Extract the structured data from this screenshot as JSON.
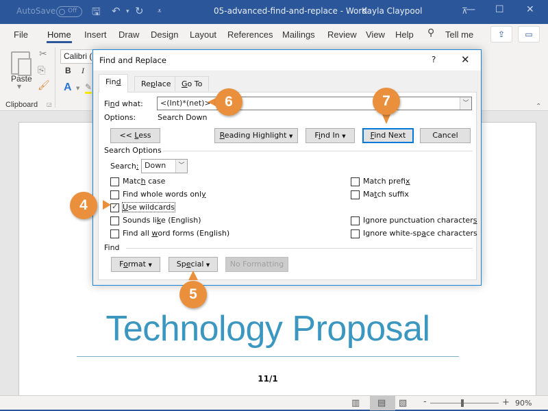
{
  "titlebar": {
    "autosave_label": "AutoSave",
    "autosave_state": "Off",
    "document_title": "05-advanced-find-and-replace - Word",
    "user_name": "Kayla Claypool"
  },
  "ribbon_tabs": [
    "File",
    "Home",
    "Insert",
    "Draw",
    "Design",
    "Layout",
    "References",
    "Mailings",
    "Review",
    "View",
    "Help"
  ],
  "active_tab": "Home",
  "tell_me": "Tell me",
  "ribbon": {
    "paste_label": "Paste",
    "clipboard_label": "Clipboard",
    "font_name": "Calibri (",
    "bold": "B",
    "italic": "I"
  },
  "dialog": {
    "title": "Find and Replace",
    "help": "?",
    "tabs": [
      {
        "pre": "Fin",
        "key": "d",
        "post": ""
      },
      {
        "pre": "Re",
        "key": "p",
        "post": "lace"
      },
      {
        "pre": "",
        "key": "G",
        "post": "o To"
      }
    ],
    "find_what_label": {
      "pre": "Fi",
      "key": "n",
      "post": "d what:"
    },
    "find_what_value": "<(Int)*(net)>",
    "options_label": "Options:",
    "options_value": "Search Down",
    "less_button": {
      "pre": "<< ",
      "key": "L",
      "post": "ess"
    },
    "reading_highlight_button": {
      "pre": "",
      "key": "R",
      "post": "eading Highlight"
    },
    "find_in_button": {
      "pre": "F",
      "key": "i",
      "post": "nd In"
    },
    "find_next_button": {
      "pre": "",
      "key": "F",
      "post": "ind Next"
    },
    "cancel_button": "Cancel",
    "search_options_label": "Search Options",
    "search_label": {
      "pre": "Search",
      "key": ":",
      "post": ""
    },
    "search_value": "Down",
    "checkboxes_left": [
      {
        "pre": "Matc",
        "key": "h",
        "post": " case",
        "checked": false
      },
      {
        "pre": "Find whole words onl",
        "key": "y",
        "post": "",
        "checked": false
      },
      {
        "pre": "",
        "key": "U",
        "post": "se wildcards",
        "checked": true
      },
      {
        "pre": "Sounds li",
        "key": "k",
        "post": "e (English)",
        "checked": false
      },
      {
        "pre": "Find all ",
        "key": "w",
        "post": "ord forms (English)",
        "checked": false
      }
    ],
    "checkboxes_right": [
      {
        "pre": "Match prefi",
        "key": "x",
        "post": "",
        "checked": false
      },
      {
        "pre": "Ma",
        "key": "t",
        "post": "ch suffix",
        "checked": false
      },
      {
        "pre": "Ignore punctuation character",
        "key": "s",
        "post": "",
        "checked": false
      },
      {
        "pre": "Ignore white-sp",
        "key": "a",
        "post": "ce characters",
        "checked": false
      }
    ],
    "find_section_label": "Find",
    "format_button": {
      "pre": "F",
      "key": "o",
      "post": "rmat"
    },
    "special_button": {
      "pre": "Sp",
      "key": "e",
      "post": "cial"
    },
    "no_formatting_button": "No Formatting"
  },
  "callouts": [
    "4",
    "5",
    "6",
    "7"
  ],
  "document": {
    "heading": "Technology Proposal",
    "date": "11/1"
  },
  "statusbar": {
    "zoom_percent": "90%",
    "zoom_level": 0.9
  },
  "colors": {
    "word_blue": "#2b579a",
    "callout_orange": "#ea8f3b",
    "heading_blue": "#3b97c0",
    "focus_blue": "#0078d7"
  }
}
